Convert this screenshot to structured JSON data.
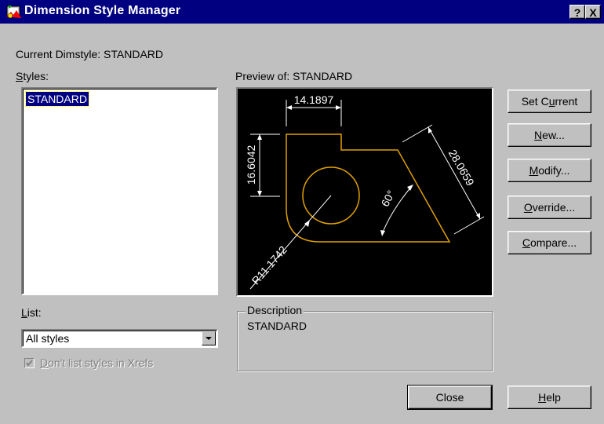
{
  "window": {
    "title": "Dimension Style Manager",
    "help_button": "?",
    "close_button": "X"
  },
  "current_dimstyle": {
    "label": "Current Dimstyle:",
    "value": "STANDARD"
  },
  "styles": {
    "label_underlined": "S",
    "label_rest": "tyles:",
    "items": [
      "STANDARD"
    ]
  },
  "preview": {
    "label": "Preview of:",
    "style": "STANDARD",
    "dimensions": {
      "top_width": "14.1897",
      "left_height": "16.6042",
      "diagonal": "28.0659",
      "angle": "60°",
      "radius": "R11.1742"
    },
    "colors": {
      "background": "#000000",
      "geometry": "#e0a000",
      "dimension": "#ffffff"
    }
  },
  "buttons": {
    "set_current": {
      "before": "Set C",
      "underlined": "u",
      "after": "rrent"
    },
    "new": {
      "before": "",
      "underlined": "N",
      "after": "ew..."
    },
    "modify": {
      "before": "",
      "underlined": "M",
      "after": "odify..."
    },
    "override": {
      "before": "",
      "underlined": "O",
      "after": "verride..."
    },
    "compare": {
      "before": "",
      "underlined": "C",
      "after": "ompare..."
    },
    "close": {
      "before": "Close",
      "underlined": "",
      "after": ""
    },
    "help": {
      "before": "",
      "underlined": "H",
      "after": "elp"
    }
  },
  "list": {
    "label_underlined": "L",
    "label_rest": "ist:",
    "selected": "All styles"
  },
  "xrefs_checkbox": {
    "before": "",
    "underlined": "D",
    "after": "on't list styles in Xrefs",
    "checked": true,
    "enabled": false
  },
  "description": {
    "legend": "Description",
    "text": "STANDARD"
  }
}
